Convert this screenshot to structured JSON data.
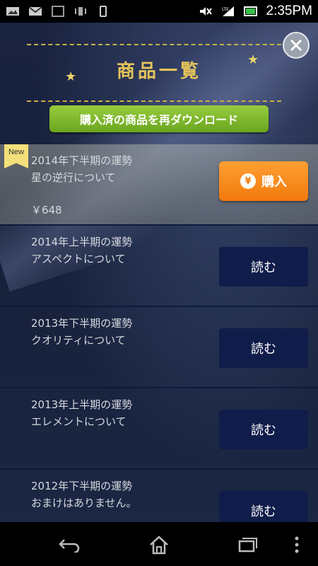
{
  "status_bar": {
    "time": "2:35PM",
    "network_label": "LTE",
    "icons": [
      "image-icon",
      "gmail-icon",
      "app-icon",
      "vibrate-icon",
      "phone-icon",
      "mute-icon",
      "signal-icon",
      "battery-icon"
    ]
  },
  "header": {
    "title": "商品一覧",
    "download_button": "購入済の商品を再ダウンロード",
    "close_icon": "close-icon"
  },
  "items": [
    {
      "title": "2014年下半期の運勢",
      "subtitle": "星の逆行について",
      "price": "￥648",
      "badge": "New",
      "button": "購入",
      "button_icon": "yen-icon",
      "state": "buy"
    },
    {
      "title": "2014年上半期の運勢",
      "subtitle": "アスペクトについて",
      "button": "読む",
      "state": "read"
    },
    {
      "title": "2013年下半期の運勢",
      "subtitle": "クオリティについて",
      "button": "読む",
      "state": "read"
    },
    {
      "title": "2013年上半期の運勢",
      "subtitle": "エレメントについて",
      "button": "読む",
      "state": "read"
    },
    {
      "title": "2012年下半期の運勢",
      "subtitle": "おまけはありません。",
      "button": "読む",
      "state": "read"
    }
  ],
  "nav_bar": {
    "icons": [
      "back-icon",
      "home-icon",
      "recent-apps-icon",
      "menu-icon"
    ]
  },
  "colors": {
    "accent_gold": "#e5c55b",
    "download_green": "#7ab52a",
    "buy_orange": "#f6891a",
    "read_navy": "#101d4a"
  }
}
